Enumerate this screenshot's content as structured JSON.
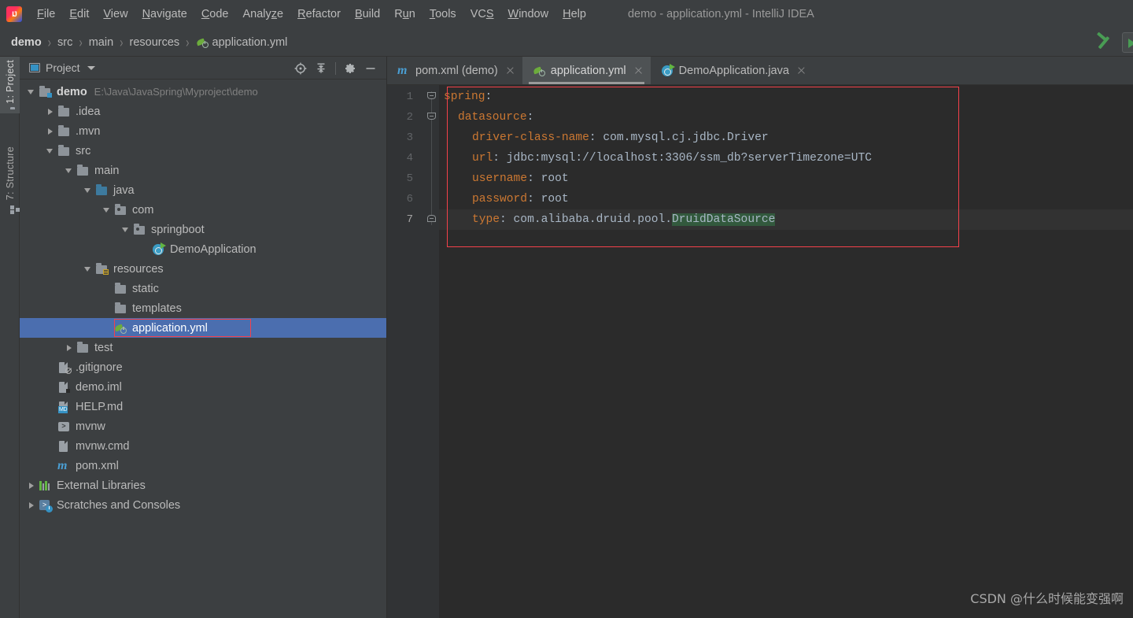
{
  "window": {
    "title": "demo - application.yml - IntelliJ IDEA",
    "logo_icon": "intellij-idea-logo"
  },
  "menubar": {
    "items": [
      {
        "label": "File",
        "mnemonic": "F"
      },
      {
        "label": "Edit",
        "mnemonic": "E"
      },
      {
        "label": "View",
        "mnemonic": "V"
      },
      {
        "label": "Navigate",
        "mnemonic": "N"
      },
      {
        "label": "Code",
        "mnemonic": "C"
      },
      {
        "label": "Analyze",
        "mnemonic": "z"
      },
      {
        "label": "Refactor",
        "mnemonic": "R"
      },
      {
        "label": "Build",
        "mnemonic": "B"
      },
      {
        "label": "Run",
        "mnemonic": "u"
      },
      {
        "label": "Tools",
        "mnemonic": "T"
      },
      {
        "label": "VCS",
        "mnemonic": "S"
      },
      {
        "label": "Window",
        "mnemonic": "W"
      },
      {
        "label": "Help",
        "mnemonic": "H"
      }
    ]
  },
  "navbar": {
    "crumbs": [
      "demo",
      "src",
      "main",
      "resources",
      "application.yml"
    ],
    "separator": "›",
    "file_icon": "spring-yaml-icon",
    "build_icon": "build-hammer-icon",
    "run_icon": "run-button-icon"
  },
  "toolstrip": {
    "tabs": [
      {
        "label": "1: Project",
        "icon": "project-folder-icon",
        "active": true
      },
      {
        "label": "7: Structure",
        "icon": "structure-icon",
        "active": false
      }
    ]
  },
  "project_panel": {
    "title": "Project",
    "view_icon": "project-view-icon",
    "dropdown_icon": "chevron-down-icon",
    "actions": [
      {
        "name": "locate-icon",
        "tooltip": "Select Opened File"
      },
      {
        "name": "collapse-all-icon",
        "tooltip": "Collapse All"
      },
      {
        "name": "gear-icon",
        "tooltip": "Settings"
      },
      {
        "name": "minimize-icon",
        "tooltip": "Hide"
      }
    ],
    "tree": [
      {
        "label": "demo",
        "sub": "E:\\Java\\JavaSpring\\Myproject\\demo",
        "depth": 0,
        "arrow": "down",
        "icon": "module-folder-icon",
        "bold": true
      },
      {
        "label": ".idea",
        "depth": 1,
        "arrow": "right",
        "icon": "folder-icon"
      },
      {
        "label": ".mvn",
        "depth": 1,
        "arrow": "right",
        "icon": "folder-icon"
      },
      {
        "label": "src",
        "depth": 1,
        "arrow": "down",
        "icon": "folder-icon"
      },
      {
        "label": "main",
        "depth": 2,
        "arrow": "down",
        "icon": "folder-icon"
      },
      {
        "label": "java",
        "depth": 3,
        "arrow": "down",
        "icon": "source-root-folder-icon"
      },
      {
        "label": "com",
        "depth": 4,
        "arrow": "down",
        "icon": "package-icon"
      },
      {
        "label": "springboot",
        "depth": 5,
        "arrow": "down",
        "icon": "package-icon"
      },
      {
        "label": "DemoApplication",
        "depth": 6,
        "arrow": "none",
        "icon": "java-runnable-class-icon"
      },
      {
        "label": "resources",
        "depth": 3,
        "arrow": "down",
        "icon": "resources-root-folder-icon"
      },
      {
        "label": "static",
        "depth": 4,
        "arrow": "none",
        "icon": "folder-icon"
      },
      {
        "label": "templates",
        "depth": 4,
        "arrow": "none",
        "icon": "folder-icon"
      },
      {
        "label": "application.yml",
        "depth": 4,
        "arrow": "none",
        "icon": "spring-yaml-icon",
        "selected": true,
        "annotated": true
      },
      {
        "label": "test",
        "depth": 2,
        "arrow": "right",
        "icon": "folder-icon"
      },
      {
        "label": ".gitignore",
        "depth": 1,
        "arrow": "none",
        "icon": "gitignore-file-icon"
      },
      {
        "label": "demo.iml",
        "depth": 1,
        "arrow": "none",
        "icon": "iml-file-icon"
      },
      {
        "label": "HELP.md",
        "depth": 1,
        "arrow": "none",
        "icon": "markdown-file-icon"
      },
      {
        "label": "mvnw",
        "depth": 1,
        "arrow": "none",
        "icon": "shell-script-icon"
      },
      {
        "label": "mvnw.cmd",
        "depth": 1,
        "arrow": "none",
        "icon": "cmd-file-icon"
      },
      {
        "label": "pom.xml",
        "depth": 1,
        "arrow": "none",
        "icon": "maven-pom-icon"
      },
      {
        "label": "External Libraries",
        "depth": 0,
        "arrow": "right",
        "icon": "external-libraries-icon"
      },
      {
        "label": "Scratches and Consoles",
        "depth": 0,
        "arrow": "right",
        "icon": "scratches-icon"
      }
    ]
  },
  "editor": {
    "tabs": [
      {
        "label": "pom.xml (demo)",
        "icon": "maven-pom-icon",
        "active": false
      },
      {
        "label": "application.yml",
        "icon": "spring-yaml-icon",
        "active": true
      },
      {
        "label": "DemoApplication.java",
        "icon": "java-runnable-class-icon",
        "active": false
      }
    ],
    "current_line": 7,
    "highlighted_text": "DruidDataSource",
    "fold_lines": [
      1,
      2,
      7
    ],
    "lines": [
      {
        "n": 1,
        "indent": 0,
        "key": "spring",
        "value": ""
      },
      {
        "n": 2,
        "indent": 2,
        "key": "datasource",
        "value": ""
      },
      {
        "n": 3,
        "indent": 4,
        "key": "driver-class-name",
        "value": "com.mysql.cj.jdbc.Driver"
      },
      {
        "n": 4,
        "indent": 4,
        "key": "url",
        "value": "jdbc:mysql://localhost:3306/ssm_db?serverTimezone=UTC"
      },
      {
        "n": 5,
        "indent": 4,
        "key": "username",
        "value": "root"
      },
      {
        "n": 6,
        "indent": 4,
        "key": "password",
        "value": "root"
      },
      {
        "n": 7,
        "indent": 4,
        "key": "type",
        "value": "com.alibaba.druid.pool.",
        "value_highlighted": "DruidDataSource"
      }
    ]
  },
  "watermark": {
    "text": "CSDN @什么时候能变强啊"
  },
  "colors": {
    "panel_bg": "#3c3f41",
    "editor_bg": "#2b2b2b",
    "gutter_bg": "#313335",
    "selection_blue": "#4b6eaf",
    "annotation_red": "#f4414a",
    "yaml_key": "#cc7832",
    "yaml_value": "#a9b7c6",
    "search_highlight": "#32593d",
    "accent_green": "#499c54"
  }
}
